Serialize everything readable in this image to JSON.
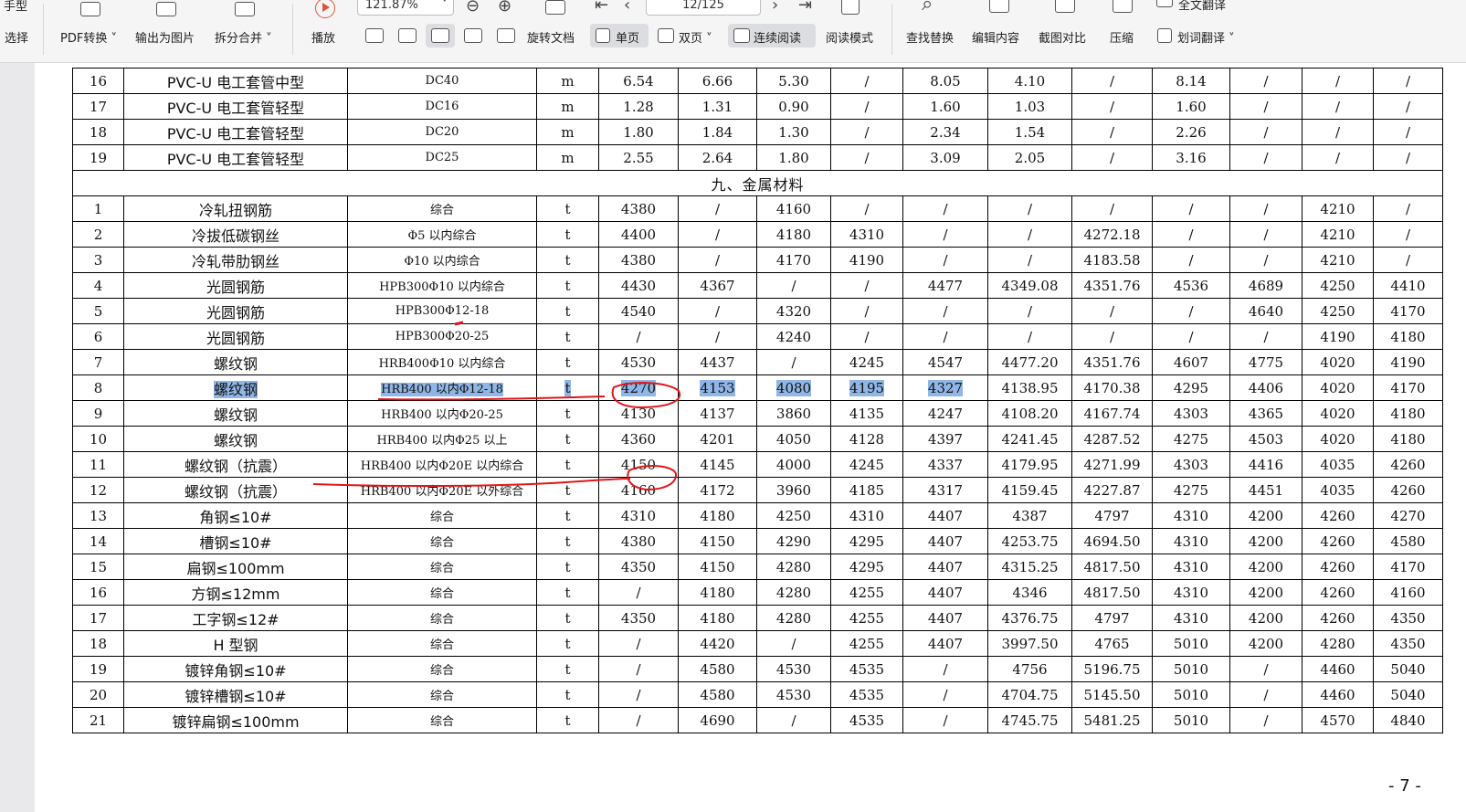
{
  "toolbar": {
    "row1": {
      "mode_partial": "手型",
      "zoom_value": "121.87%",
      "page_value": "12/125",
      "fulltext_translate": "全文翻译"
    },
    "row2": {
      "select": "选择",
      "pdf_convert": "PDF转换",
      "export_image": "输出为图片",
      "split_merge": "拆分合并",
      "play": "播放",
      "rotate_doc": "旋转文档",
      "single_page": "单页",
      "double_page": "双页",
      "continuous_read": "连续阅读",
      "read_mode": "阅读模式",
      "find_replace": "查找替换",
      "edit_content": "编辑内容",
      "screenshot_compare": "截图对比",
      "compress": "压缩",
      "word_translate": "划词翻译"
    },
    "icons": {
      "play": "play-icon",
      "zoom_out": "zoom-out-icon",
      "zoom_in": "zoom-in-icon",
      "first_page": "first-page-icon",
      "prev_page": "prev-page-icon",
      "next_page": "next-page-icon",
      "last_page": "last-page-icon",
      "search": "search-icon"
    }
  },
  "table": {
    "rows_top": [
      [
        "16",
        "PVC-U 电工套管中型",
        "DC40",
        "m",
        "6.54",
        "6.66",
        "5.30",
        "/",
        "8.05",
        "4.10",
        "/",
        "8.14",
        "/",
        "/",
        "/"
      ],
      [
        "17",
        "PVC-U 电工套管轻型",
        "DC16",
        "m",
        "1.28",
        "1.31",
        "0.90",
        "/",
        "1.60",
        "1.03",
        "/",
        "1.60",
        "/",
        "/",
        "/"
      ],
      [
        "18",
        "PVC-U 电工套管轻型",
        "DC20",
        "m",
        "1.80",
        "1.84",
        "1.30",
        "/",
        "2.34",
        "1.54",
        "/",
        "2.26",
        "/",
        "/",
        "/"
      ],
      [
        "19",
        "PVC-U 电工套管轻型",
        "DC25",
        "m",
        "2.55",
        "2.64",
        "1.80",
        "/",
        "3.09",
        "2.05",
        "/",
        "3.16",
        "/",
        "/",
        "/"
      ]
    ],
    "section_title": "九、金属材料",
    "rows": [
      [
        "1",
        "冷轧扭钢筋",
        "综合",
        "t",
        "4380",
        "/",
        "4160",
        "/",
        "/",
        "/",
        "/",
        "/",
        "/",
        "4210",
        "/"
      ],
      [
        "2",
        "冷拔低碳钢丝",
        "Φ5 以内综合",
        "t",
        "4400",
        "/",
        "4180",
        "4310",
        "/",
        "/",
        "4272.18",
        "/",
        "/",
        "4210",
        "/"
      ],
      [
        "3",
        "冷轧带肋钢丝",
        "Φ10 以内综合",
        "t",
        "4380",
        "/",
        "4170",
        "4190",
        "/",
        "/",
        "4183.58",
        "/",
        "/",
        "4210",
        "/"
      ],
      [
        "4",
        "光圆钢筋",
        "HPB300Φ10 以内综合",
        "t",
        "4430",
        "4367",
        "/",
        "/",
        "4477",
        "4349.08",
        "4351.76",
        "4536",
        "4689",
        "4250",
        "4410"
      ],
      [
        "5",
        "光圆钢筋",
        "HPB300Φ12-18",
        "t",
        "4540",
        "/",
        "4320",
        "/",
        "/",
        "/",
        "/",
        "/",
        "4640",
        "4250",
        "4170"
      ],
      [
        "6",
        "光圆钢筋",
        "HPB300Φ20-25",
        "t",
        "/",
        "/",
        "4240",
        "/",
        "/",
        "/",
        "/",
        "/",
        "/",
        "4190",
        "4180"
      ],
      [
        "7",
        "螺纹钢",
        "HRB400Φ10 以内综合",
        "t",
        "4530",
        "4437",
        "/",
        "4245",
        "4547",
        "4477.20",
        "4351.76",
        "4607",
        "4775",
        "4020",
        "4190"
      ],
      [
        "8",
        "螺纹钢",
        "HRB400 以内Φ12-18",
        "t",
        "4270",
        "4153",
        "4080",
        "4195",
        "4327",
        "4138.95",
        "4170.38",
        "4295",
        "4406",
        "4020",
        "4170"
      ],
      [
        "9",
        "螺纹钢",
        "HRB400 以内Φ20-25",
        "t",
        "4130",
        "4137",
        "3860",
        "4135",
        "4247",
        "4108.20",
        "4167.74",
        "4303",
        "4365",
        "4020",
        "4180"
      ],
      [
        "10",
        "螺纹钢",
        "HRB400 以内Φ25 以上",
        "t",
        "4360",
        "4201",
        "4050",
        "4128",
        "4397",
        "4241.45",
        "4287.52",
        "4275",
        "4503",
        "4020",
        "4180"
      ],
      [
        "11",
        "螺纹钢（抗震）",
        "HRB400 以内Φ20E 以内综合",
        "t",
        "4150",
        "4145",
        "4000",
        "4245",
        "4337",
        "4179.95",
        "4271.99",
        "4303",
        "4416",
        "4035",
        "4260"
      ],
      [
        "12",
        "螺纹钢（抗震）",
        "HRB400 以内Φ20E 以外综合",
        "t",
        "4160",
        "4172",
        "3960",
        "4185",
        "4317",
        "4159.45",
        "4227.87",
        "4275",
        "4451",
        "4035",
        "4260"
      ],
      [
        "13",
        "角钢≤10#",
        "综合",
        "t",
        "4310",
        "4180",
        "4250",
        "4310",
        "4407",
        "4387",
        "4797",
        "4310",
        "4200",
        "4260",
        "4270"
      ],
      [
        "14",
        "槽钢≤10#",
        "综合",
        "t",
        "4380",
        "4150",
        "4290",
        "4295",
        "4407",
        "4253.75",
        "4694.50",
        "4310",
        "4200",
        "4260",
        "4580"
      ],
      [
        "15",
        "扁钢≤100mm",
        "综合",
        "t",
        "4350",
        "4150",
        "4280",
        "4295",
        "4407",
        "4315.25",
        "4817.50",
        "4310",
        "4200",
        "4260",
        "4170"
      ],
      [
        "16",
        "方钢≤12mm",
        "综合",
        "t",
        "/",
        "4180",
        "4280",
        "4255",
        "4407",
        "4346",
        "4817.50",
        "4310",
        "4200",
        "4260",
        "4160"
      ],
      [
        "17",
        "工字钢≤12#",
        "综合",
        "t",
        "4350",
        "4180",
        "4280",
        "4255",
        "4407",
        "4376.75",
        "4797",
        "4310",
        "4200",
        "4260",
        "4350"
      ],
      [
        "18",
        "H 型钢",
        "综合",
        "t",
        "/",
        "4420",
        "/",
        "4255",
        "4407",
        "3997.50",
        "4765",
        "5010",
        "4200",
        "4280",
        "4350"
      ],
      [
        "19",
        "镀锌角钢≤10#",
        "综合",
        "t",
        "/",
        "4580",
        "4530",
        "4535",
        "/",
        "4756",
        "5196.75",
        "5010",
        "/",
        "4460",
        "5040"
      ],
      [
        "20",
        "镀锌槽钢≤10#",
        "综合",
        "t",
        "/",
        "4580",
        "4530",
        "4535",
        "/",
        "4704.75",
        "5145.50",
        "5010",
        "/",
        "4460",
        "5040"
      ],
      [
        "21",
        "镀锌扁钢≤100mm",
        "综合",
        "t",
        "/",
        "4690",
        "/",
        "4535",
        "/",
        "4745.75",
        "5481.25",
        "5010",
        "/",
        "4570",
        "4840"
      ]
    ]
  },
  "page_number": "- 7 -",
  "colors": {
    "annotation_red": "#e0161b",
    "selection_blue": "#8fb6e6"
  }
}
